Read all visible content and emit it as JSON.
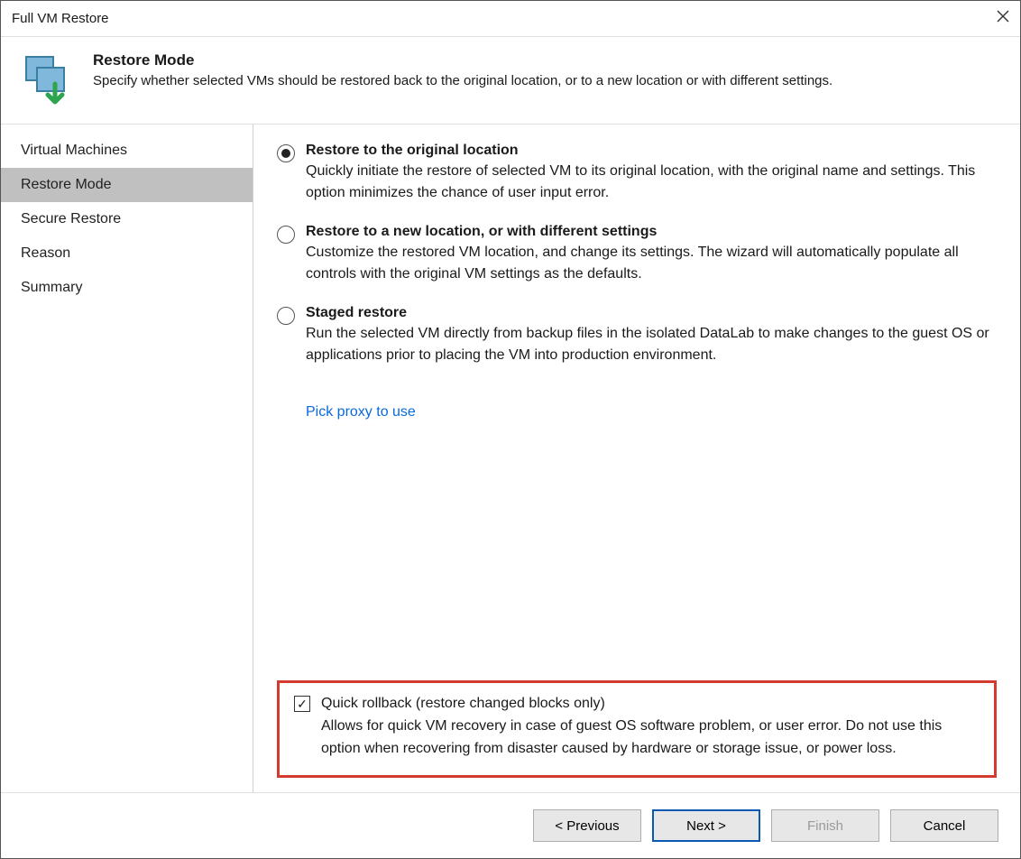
{
  "window": {
    "title": "Full VM Restore"
  },
  "header": {
    "title": "Restore Mode",
    "subtitle": "Specify whether selected VMs should be restored back to the original location, or to a new location or with different settings."
  },
  "sidebar": {
    "items": [
      {
        "label": "Virtual Machines",
        "active": false
      },
      {
        "label": "Restore Mode",
        "active": true
      },
      {
        "label": "Secure Restore",
        "active": false
      },
      {
        "label": "Reason",
        "active": false
      },
      {
        "label": "Summary",
        "active": false
      }
    ]
  },
  "options": [
    {
      "title": "Restore to the original location",
      "desc": "Quickly initiate the restore of selected VM to its original location, with the original name and settings. This option minimizes the chance of user input error.",
      "selected": true
    },
    {
      "title": "Restore to a new location, or with different settings",
      "desc": "Customize the restored VM location, and change its settings. The wizard will automatically populate all controls with the original VM settings as the defaults.",
      "selected": false
    },
    {
      "title": "Staged restore",
      "desc": "Run the selected VM directly from backup files in the isolated DataLab to make changes to the guest OS or applications prior to placing the VM into production environment.",
      "selected": false
    }
  ],
  "proxy_link": "Pick proxy to use",
  "rollback": {
    "checked": true,
    "checkmark": "✓",
    "label": "Quick rollback (restore changed blocks only)",
    "desc": "Allows for quick VM recovery in case of guest OS software problem, or user error. Do not use this option when recovering from disaster caused by hardware or storage issue, or power loss."
  },
  "footer": {
    "previous": "< Previous",
    "next": "Next >",
    "finish": "Finish",
    "cancel": "Cancel"
  }
}
